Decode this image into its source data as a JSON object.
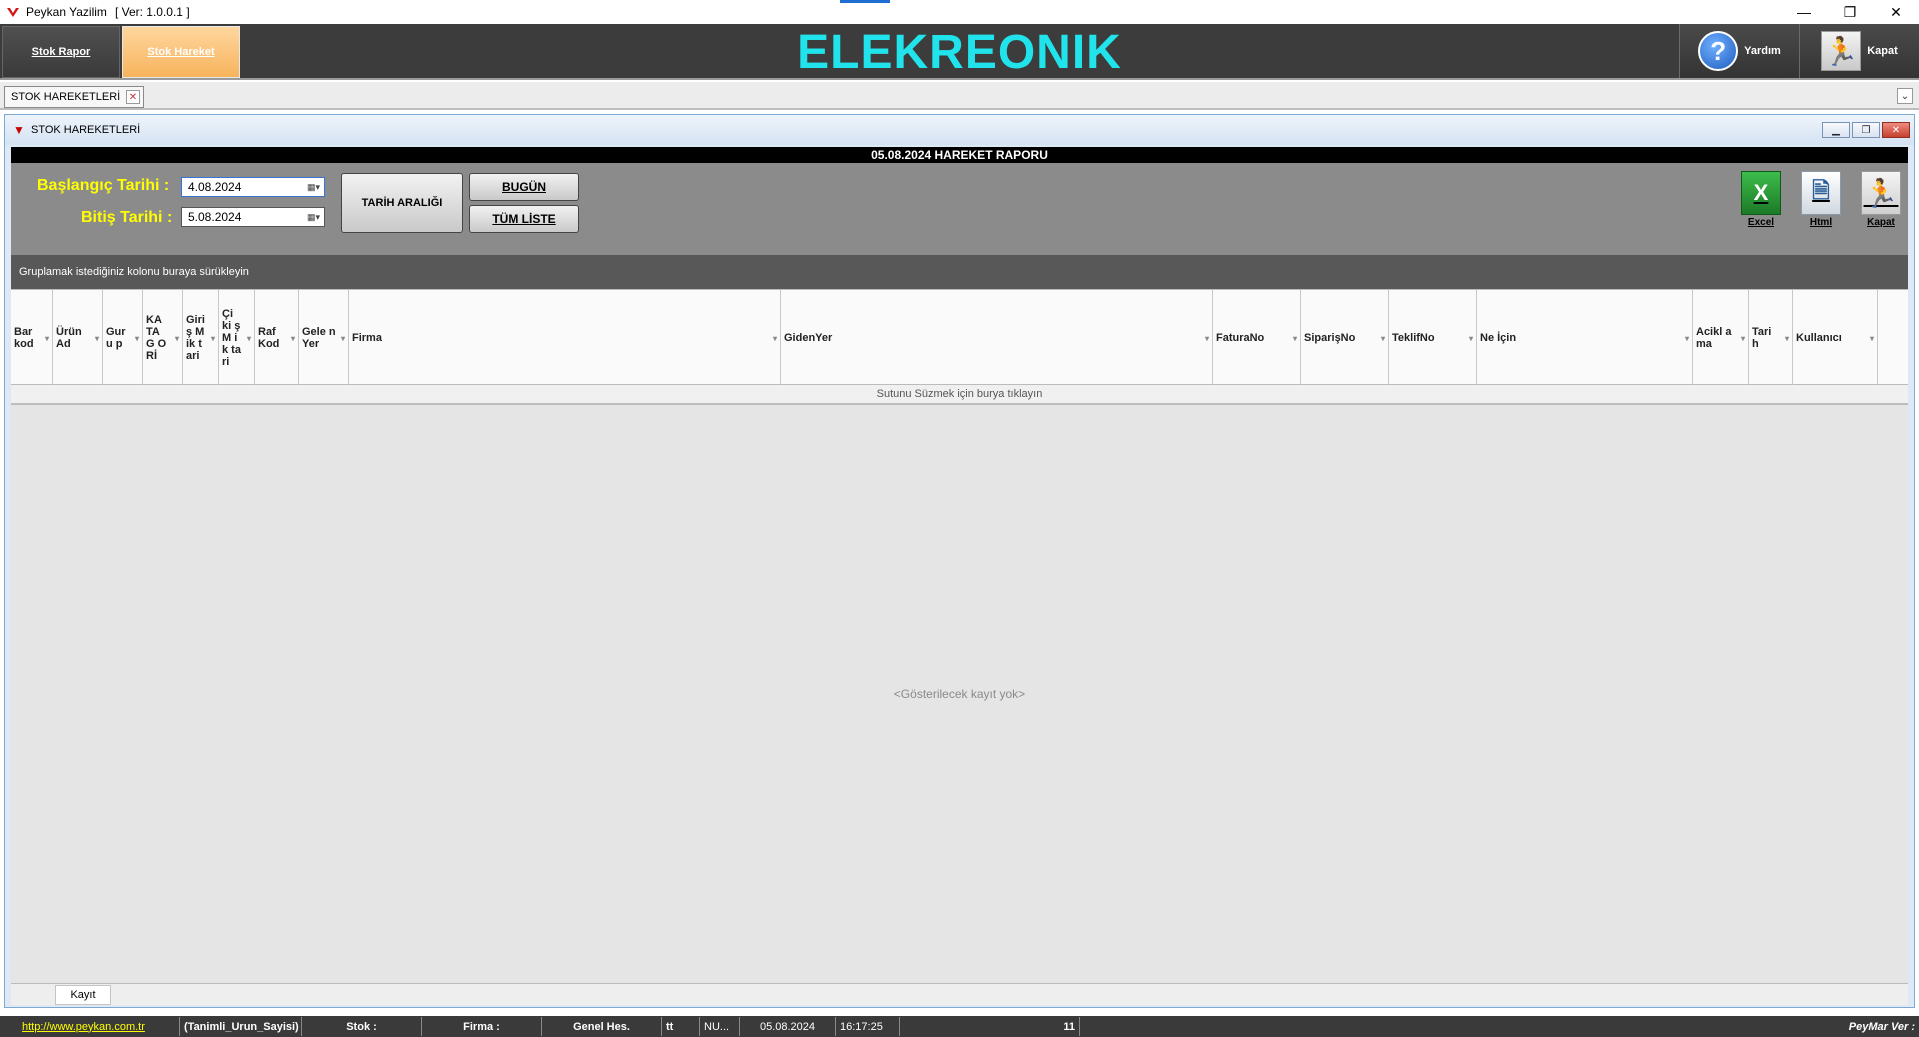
{
  "titlebar": {
    "title": "Peykan Yazilim",
    "version": "[ Ver: 1.0.0.1 ]",
    "minimize": "—",
    "restore": "❐",
    "close": "✕"
  },
  "header": {
    "nav": [
      "Stok Rapor",
      "Stok Hareket"
    ],
    "brand": "ELEKREONIK",
    "help_label": "Yardım",
    "close_label": "Kapat"
  },
  "tabs": {
    "doc_tab": "STOK HAREKETLERİ"
  },
  "window": {
    "title": "STOK HAREKETLERİ",
    "report_title": "05.08.2024  HAREKET RAPORU"
  },
  "filters": {
    "start_label": "Başlangıç Tarihi :",
    "start_value": "4.08.2024",
    "end_label": "Bitiş Tarihi :",
    "end_value": "5.08.2024",
    "range_button": "TARİH ARALIĞI",
    "today_button": "BUGÜN",
    "all_button": "TÜM LİSTE"
  },
  "tools": {
    "excel": "Excel",
    "html": "Html",
    "kapat": "Kapat"
  },
  "grid": {
    "group_hint": "Gruplamak istediğiniz kolonu buraya sürükleyin",
    "columns": [
      "Bar kod",
      "Ürün Ad",
      "Guru p",
      "KA TA G O Rİ",
      "Giri ş Mik tari",
      "Çi ki ş M ik ta ri",
      "Raf Kod",
      "Gele nYer",
      "Firma",
      "GidenYer",
      "FaturaNo",
      "SiparişNo",
      "TeklifNo",
      "Ne İçin",
      "Acikl ama",
      "Tari h",
      "Kullanıcı"
    ],
    "filter_hint": "Sutunu Süzmek için burya tıklayın",
    "empty_text": "<Gösterilecek kayıt yok>",
    "footer_label": "Kayıt"
  },
  "statusbar": {
    "link": "http://www.peykan.com.tr",
    "items": [
      "(Tanimli_Urun_Sayisi)",
      "Stok :",
      "Firma :",
      "Genel Hes.",
      "tt",
      "NU...",
      "05.08.2024",
      "16:17:25",
      "11"
    ],
    "version": "PeyMar Ver :"
  }
}
